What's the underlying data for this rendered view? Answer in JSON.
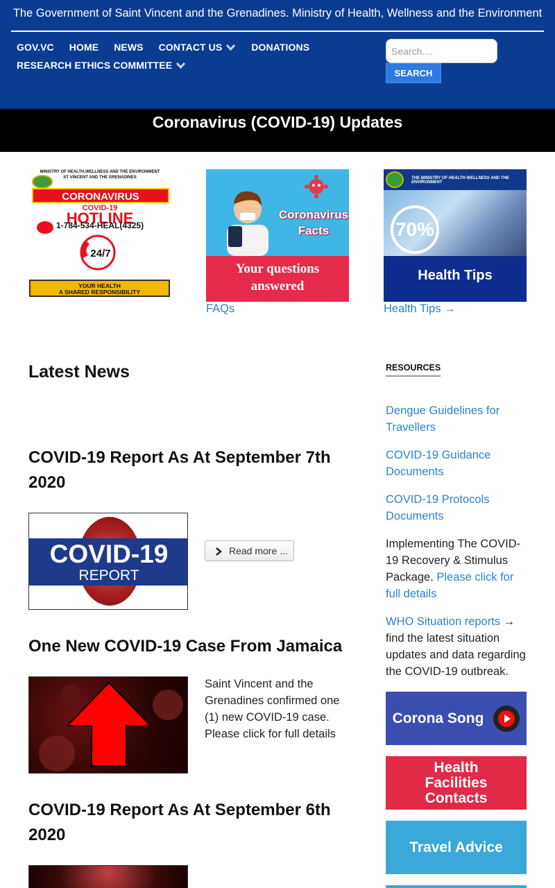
{
  "header": {
    "gov_title": "The Government of Saint Vincent and the Grenadines. Ministry of Health, Wellness and the Environment",
    "nav": [
      "GOV.VC",
      "HOME",
      "NEWS",
      "CONTACT US",
      "DONATIONS",
      "RESEARCH ETHICS COMMITTEE"
    ],
    "search_placeholder": "Search....",
    "search_button": "SEARCH",
    "colors": {
      "header_bg": "#0a3d91",
      "search_button": "#2d7be2"
    }
  },
  "banner": {
    "title": "Coronavirus (COVID-19) Updates"
  },
  "features": {
    "hotline": {
      "ministry": "MINISTRY OF HEALTH,WELLNESS AND THE ENVIRONMENT",
      "country": "ST VINCENT AND THE GRENADINES",
      "coronavirus": "CORONAVIRUS",
      "covid": "COVID-19",
      "hotline": "HOTLINE",
      "phone": "1-784-534-HEAL(4325)",
      "hours": "24/7",
      "slogan_1": "YOUR HEALTH",
      "slogan_2": "A SHARED RESPONSIBILITY"
    },
    "facts": {
      "title_1": "Coronavirus",
      "title_2": "Facts",
      "subtitle_1": "Your questions",
      "subtitle_2": "answered",
      "link": "FAQs"
    },
    "tips": {
      "topbar": "THE MINISTRY OF HEALTH WELLNESS AND THE ENVIRONMENT",
      "percent": "70%",
      "title": "Health Tips",
      "link": "Health Tips →"
    }
  },
  "news": {
    "heading": "Latest News",
    "read_more": "Read more ...",
    "articles": [
      {
        "title": "COVID-19 Report As At September 7th 2020",
        "thumb_line1": "COVID-19",
        "thumb_line2": "REPORT"
      },
      {
        "title": "One New COVID-19 Case From Jamaica",
        "summary": "Saint Vincent and the Grenadines confirmed one (1) new COVID-19 case. Please click for full details"
      },
      {
        "title": "COVID-19 Report As At September 6th 2020"
      }
    ]
  },
  "resources": {
    "heading": "RESOURCES",
    "links": [
      "Dengue Guidelines for Travellers",
      "COVID-19 Guidance Documents",
      "COVID-19 Protocols Documents"
    ],
    "stimulus_text": "Implementing The COVID-19 Recovery & Stimulus Package.",
    "stimulus_link": "Please click for full details",
    "who_link": "WHO Situation reports",
    "who_text": "→ find the latest situation updates and data regarding the COVID-19 outbreak.",
    "buttons": [
      "Corona Song",
      "Health Facilities Contacts",
      "Travel Advice"
    ]
  }
}
